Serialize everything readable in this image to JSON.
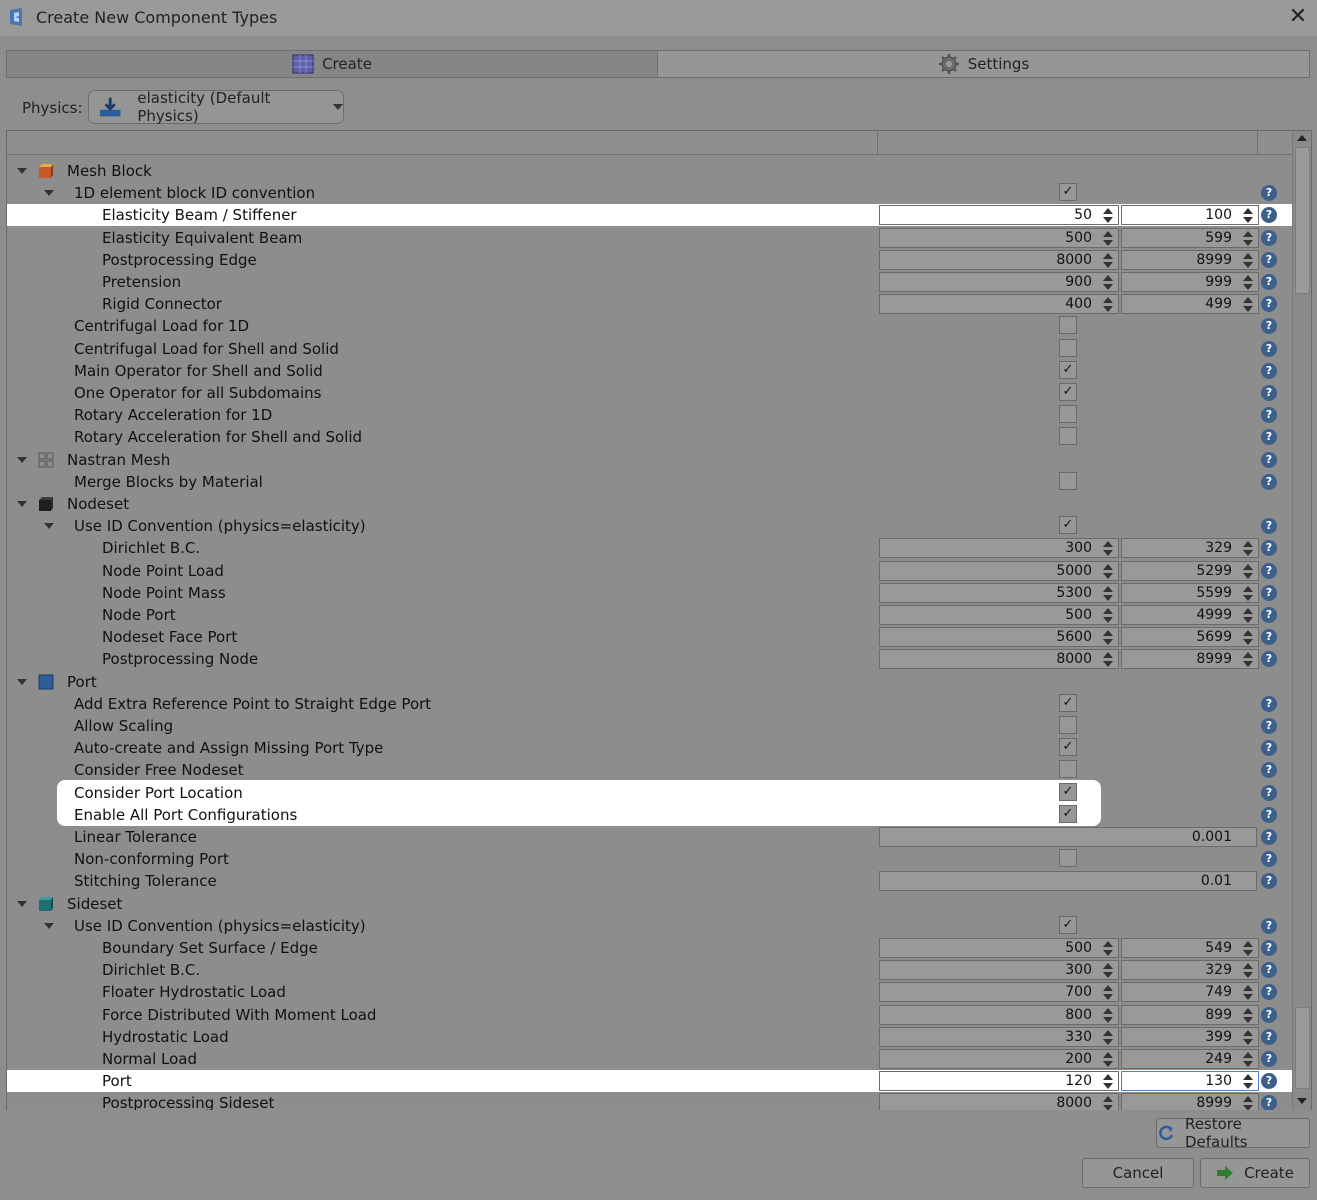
{
  "window": {
    "title": "Create New Component Types"
  },
  "tabs": [
    {
      "label": "Create",
      "icon": "create-grid-icon"
    },
    {
      "label": "Settings",
      "icon": "gear-icon"
    }
  ],
  "physics": {
    "label": "Physics:",
    "value": "elasticity (Default Physics)"
  },
  "rows": [
    {
      "label": "Mesh Block"
    },
    {
      "label": "1D element block ID convention"
    },
    {
      "label": "Elasticity Beam / Stiffener",
      "from": "50",
      "to": "100"
    },
    {
      "label": "Elasticity Equivalent Beam",
      "from": "500",
      "to": "599"
    },
    {
      "label": "Postprocessing Edge",
      "from": "8000",
      "to": "8999"
    },
    {
      "label": "Pretension",
      "from": "900",
      "to": "999"
    },
    {
      "label": "Rigid Connector",
      "from": "400",
      "to": "499"
    },
    {
      "label": "Centrifugal Load for 1D"
    },
    {
      "label": "Centrifugal Load for Shell and Solid"
    },
    {
      "label": "Main Operator for Shell and Solid"
    },
    {
      "label": "One Operator for all Subdomains"
    },
    {
      "label": "Rotary Acceleration for 1D"
    },
    {
      "label": "Rotary Acceleration for Shell and Solid"
    },
    {
      "label": "Nastran Mesh"
    },
    {
      "label": "Merge Blocks by Material"
    },
    {
      "label": "Nodeset"
    },
    {
      "label": "Use ID Convention (physics=elasticity)"
    },
    {
      "label": "Dirichlet B.C.",
      "from": "300",
      "to": "329"
    },
    {
      "label": "Node Point Load",
      "from": "5000",
      "to": "5299"
    },
    {
      "label": "Node Point Mass",
      "from": "5300",
      "to": "5599"
    },
    {
      "label": "Node Port",
      "from": "500",
      "to": "4999"
    },
    {
      "label": "Nodeset Face Port",
      "from": "5600",
      "to": "5699"
    },
    {
      "label": "Postprocessing Node",
      "from": "8000",
      "to": "8999"
    },
    {
      "label": "Port"
    },
    {
      "label": "Add Extra Reference Point to Straight Edge Port"
    },
    {
      "label": "Allow Scaling"
    },
    {
      "label": "Auto-create and Assign Missing Port Type"
    },
    {
      "label": "Consider Free Nodeset"
    },
    {
      "label": "Consider Port Location"
    },
    {
      "label": "Enable All Port Configurations"
    },
    {
      "label": "Linear Tolerance",
      "value": "0.001"
    },
    {
      "label": "Non-conforming Port"
    },
    {
      "label": "Stitching Tolerance",
      "value": "0.01"
    },
    {
      "label": "Sideset"
    },
    {
      "label": "Use ID Convention (physics=elasticity)"
    },
    {
      "label": "Boundary Set Surface / Edge",
      "from": "500",
      "to": "549"
    },
    {
      "label": "Dirichlet B.C.",
      "from": "300",
      "to": "329"
    },
    {
      "label": "Floater Hydrostatic Load",
      "from": "700",
      "to": "749"
    },
    {
      "label": "Force Distributed With Moment Load",
      "from": "800",
      "to": "899"
    },
    {
      "label": "Hydrostatic Load",
      "from": "330",
      "to": "399"
    },
    {
      "label": "Normal Load",
      "from": "200",
      "to": "249"
    },
    {
      "label": "Port",
      "from": "120",
      "to": "130"
    },
    {
      "label": "Postprocessing Sideset",
      "from": "8000",
      "to": "8999"
    }
  ],
  "buttons": {
    "restore_defaults": "Restore Defaults",
    "cancel": "Cancel",
    "create": "Create"
  },
  "checkmark": "✓",
  "help": "?"
}
